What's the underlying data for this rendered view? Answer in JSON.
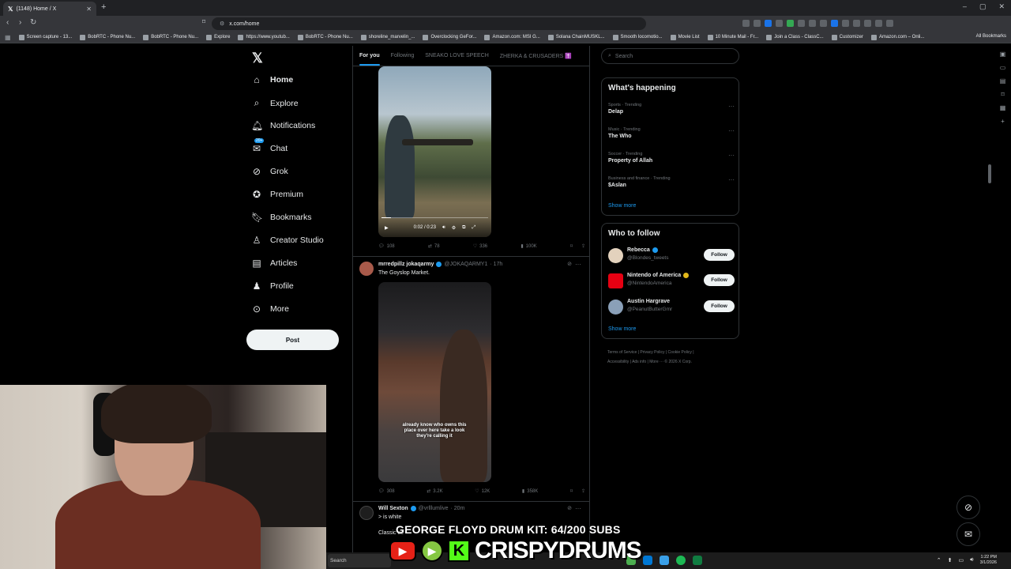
{
  "browser": {
    "tab_title": "(1148) Home / X",
    "url": "x.com/home",
    "bookmarks": [
      "Screen capture - 13...",
      "BobRTC - Phone Nu...",
      "BobRTC - Phone Nu...",
      "Explore",
      "https://www.youtub...",
      "BobRTC - Phone Nu...",
      "shoreline_marvelin_...",
      "Overclocking GeFor...",
      "Amazon.com: MSI G...",
      "Solana ChainMUSKL...",
      "Smooth locomotio...",
      "Movie List",
      "10 Minute Mail - Fr...",
      "Join a Class - ClassC...",
      "Customizer",
      "Amazon.com – Onli..."
    ],
    "all_bookmarks": "All Bookmarks"
  },
  "nav": {
    "items": [
      {
        "label": "Home",
        "icon": "home-icon"
      },
      {
        "label": "Explore",
        "icon": "search-icon"
      },
      {
        "label": "Notifications",
        "icon": "bell-icon"
      },
      {
        "label": "Chat",
        "icon": "mail-icon"
      },
      {
        "label": "Grok",
        "icon": "grok-icon"
      },
      {
        "label": "Premium",
        "icon": "premium-icon"
      },
      {
        "label": "Bookmarks",
        "icon": "bookmark-icon"
      },
      {
        "label": "Creator Studio",
        "icon": "creator-icon"
      },
      {
        "label": "Articles",
        "icon": "articles-icon"
      },
      {
        "label": "Profile",
        "icon": "profile-icon"
      },
      {
        "label": "More",
        "icon": "more-icon"
      }
    ],
    "chat_badge": "20+",
    "post_label": "Post"
  },
  "feed": {
    "tabs": [
      "For you",
      "Following",
      "SNEAKO LOVE SPEECH",
      "ZHERKA & CRUSADERS ✝️"
    ],
    "video1": {
      "time": "0:02 / 0:23",
      "progress": 0.09,
      "replies": "108",
      "reposts": "78",
      "likes": "336",
      "views": "100K"
    },
    "tweet2": {
      "name": "mrredpillz jokaqarmy",
      "handle": "@JOKAQARMY1",
      "time": "· 17h",
      "text": "The Goyslop Market.",
      "caption": "already know who owns this place over here take a look they're calling it",
      "replies": "308",
      "reposts": "3.2K",
      "likes": "12K",
      "views": "358K"
    },
    "tweet3": {
      "name": "Will Sexton",
      "handle": "@vrlllumlive",
      "time": "· 20m",
      "text": "> is white",
      "text2": "Classic ac"
    }
  },
  "sidebar": {
    "search_placeholder": "Search",
    "happening_title": "What's happening",
    "trends": [
      {
        "category": "Sports · Trending",
        "name": "Delap"
      },
      {
        "category": "Music · Trending",
        "name": "The Who"
      },
      {
        "category": "Soccer · Trending",
        "name": "Property of Allah"
      },
      {
        "category": "Business and finance · Trending",
        "name": "$Aslan"
      }
    ],
    "show_more": "Show more",
    "who_title": "Who to follow",
    "who": [
      {
        "name": "Rebecca",
        "handle": "@Blondes_tweets",
        "verified_color": "#1d9bf0"
      },
      {
        "name": "Nintendo of America",
        "handle": "@NintendoAmerica",
        "verified_color": "#e2b719"
      },
      {
        "name": "Austin Hargrave",
        "handle": "@PeanutButterGmr",
        "verified_color": ""
      }
    ],
    "follow_label": "Follow",
    "footer": [
      "Terms of Service",
      "|",
      "Privacy Policy",
      "|",
      "Cookie Policy",
      "|",
      "Accessibility",
      "|",
      "Ads info",
      "|",
      "More ···",
      "© 2026 X Corp."
    ]
  },
  "overlay": {
    "title": "GEORGE FLOYD DRUM KIT: 64/200 SUBS",
    "brand": "CRISPYDRUMS"
  },
  "taskbar": {
    "search": "Search",
    "time": "1:22 PM",
    "date": "3/1/2026"
  },
  "colors": {
    "accent": "#1d9bf0",
    "background": "#000000",
    "text": "#e7e9ea",
    "muted": "#71767b"
  }
}
